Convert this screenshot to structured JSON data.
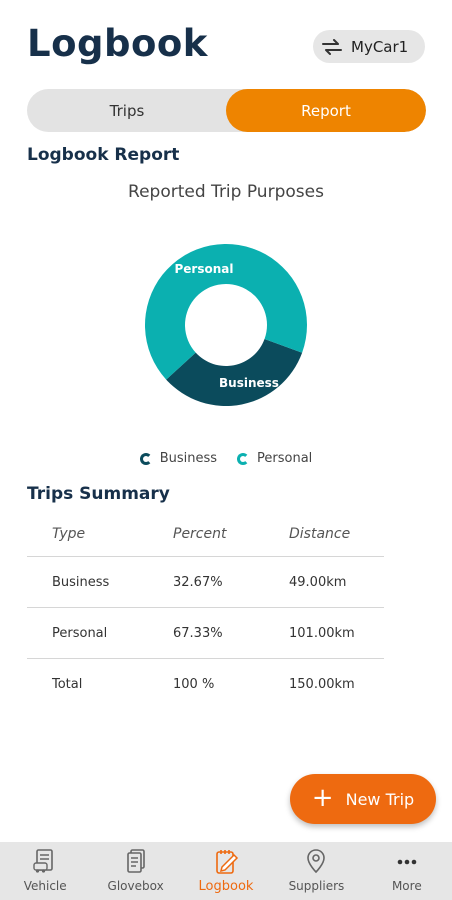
{
  "header": {
    "title": "Logbook",
    "car_label": "MyCar1"
  },
  "tabs": [
    {
      "label": "Trips"
    },
    {
      "label": "Report",
      "active": true
    }
  ],
  "report": {
    "heading": "Logbook Report",
    "chart_title": "Reported Trip Purposes"
  },
  "colors": {
    "accent": "#ee8400",
    "fab": "#ee6a10",
    "business": "#0b4b5c",
    "personal": "#0bb0b0"
  },
  "chart_data": {
    "type": "pie",
    "title": "Reported Trip Purposes",
    "donut": true,
    "slices": [
      {
        "name": "Business",
        "value": 32.67,
        "color": "#0b4b5c"
      },
      {
        "name": "Personal",
        "value": 67.33,
        "color": "#0bb0b0"
      }
    ],
    "legend": [
      "Business",
      "Personal"
    ],
    "legend_placement": "bottom"
  },
  "summary": {
    "heading": "Trips Summary",
    "columns": [
      "Type",
      "Percent",
      "Distance"
    ],
    "rows": [
      [
        "Business",
        "32.67%",
        "49.00km"
      ],
      [
        "Personal",
        "67.33%",
        "101.00km"
      ],
      [
        "Total",
        "100 %",
        "150.00km"
      ]
    ]
  },
  "fab": {
    "label": "New Trip",
    "icon": "plus-icon"
  },
  "nav": [
    {
      "label": "Vehicle",
      "icon": "vehicle-document-icon"
    },
    {
      "label": "Glovebox",
      "icon": "glovebox-documents-icon"
    },
    {
      "label": "Logbook",
      "icon": "logbook-edit-icon",
      "active": true
    },
    {
      "label": "Suppliers",
      "icon": "map-pin-icon"
    },
    {
      "label": "More",
      "icon": "more-dots-icon"
    }
  ]
}
